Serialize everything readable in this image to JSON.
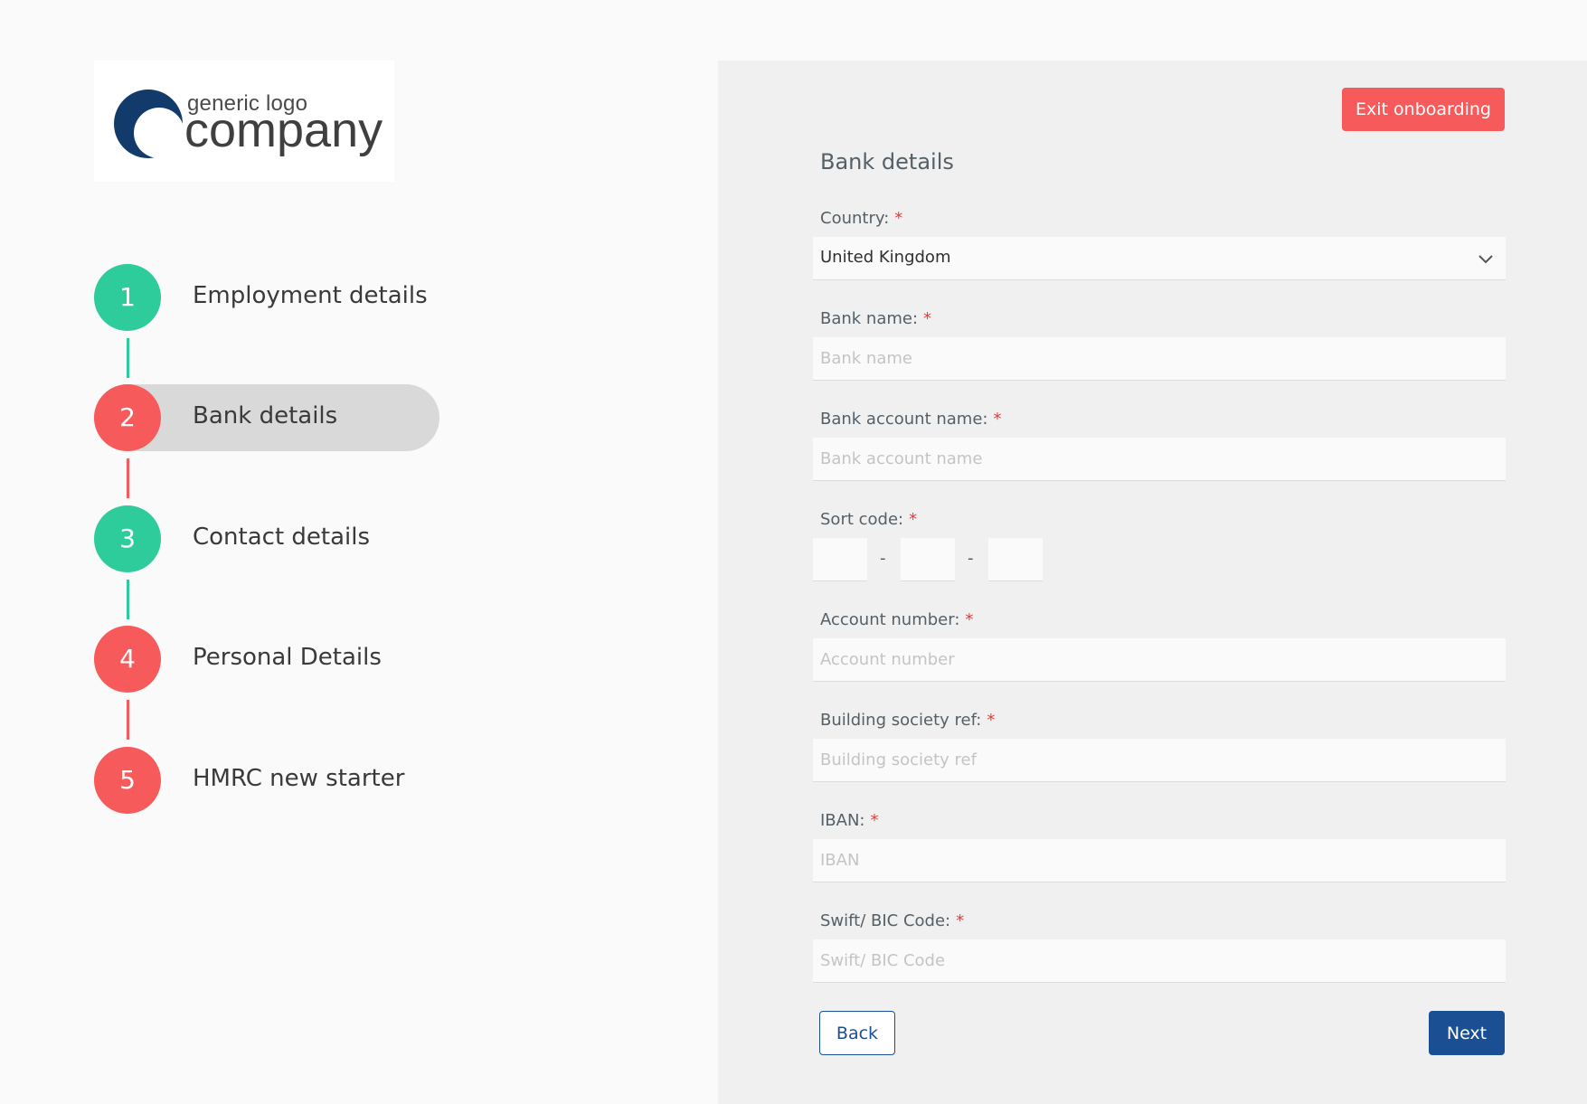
{
  "logo": {
    "line1": "generic logo",
    "line2": "company",
    "icon": "crescent-logo-icon"
  },
  "colors": {
    "step_complete": "#2ecc9a",
    "step_incomplete": "#f75a5a",
    "primary": "#1b4f93",
    "danger": "#f75a5a"
  },
  "steps": [
    {
      "number": "1",
      "label": "Employment details",
      "status": "complete"
    },
    {
      "number": "2",
      "label": "Bank details",
      "status": "active"
    },
    {
      "number": "3",
      "label": "Contact details",
      "status": "complete"
    },
    {
      "number": "4",
      "label": "Personal Details",
      "status": "incomplete"
    },
    {
      "number": "5",
      "label": "HMRC new starter",
      "status": "incomplete"
    }
  ],
  "header": {
    "exit_label": "Exit onboarding"
  },
  "form": {
    "title": "Bank details",
    "country": {
      "label": "Country:",
      "value": "United Kingdom",
      "icon": "chevron-down-icon"
    },
    "bank_name": {
      "label": "Bank name:",
      "placeholder": "Bank name"
    },
    "bank_account_name": {
      "label": "Bank account name:",
      "placeholder": "Bank account name"
    },
    "sort_code": {
      "label": "Sort code:",
      "separator": "-"
    },
    "account_number": {
      "label": "Account number:",
      "placeholder": "Account number"
    },
    "building_society_ref": {
      "label": "Building society ref:",
      "placeholder": "Building society ref"
    },
    "iban": {
      "label": "IBAN:",
      "placeholder": "IBAN"
    },
    "swift": {
      "label": "Swift/ BIC Code:",
      "placeholder": "Swift/ BIC Code"
    },
    "required_mark": "*"
  },
  "footer": {
    "back_label": "Back",
    "next_label": "Next"
  }
}
